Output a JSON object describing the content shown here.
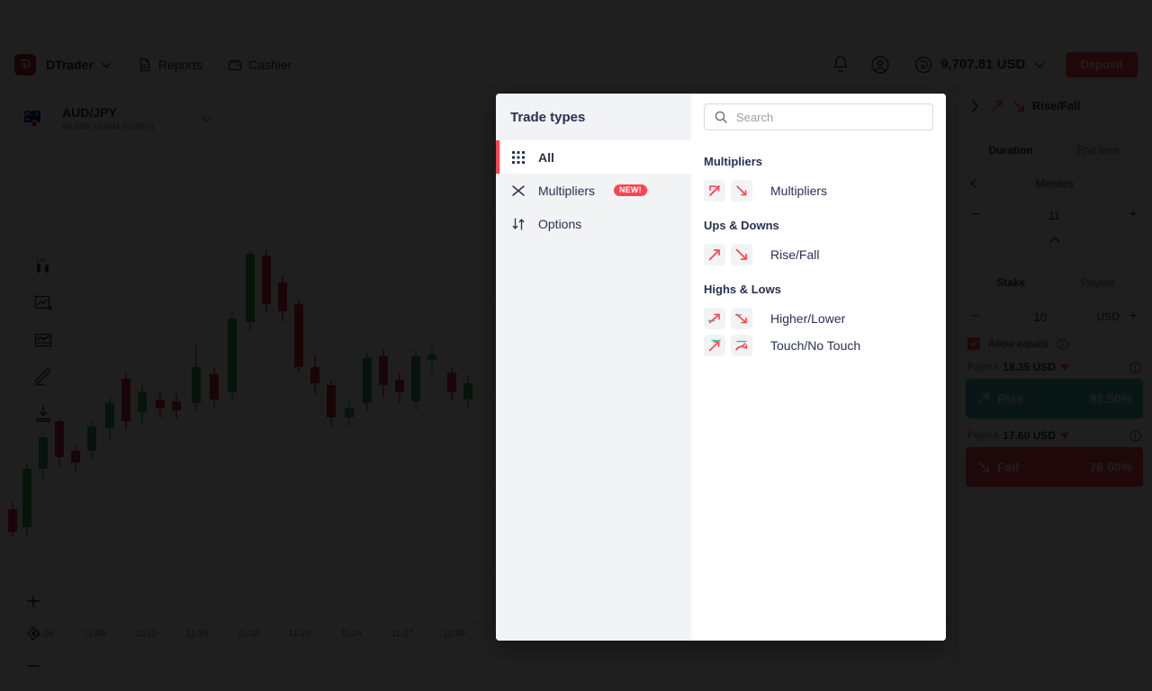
{
  "header": {
    "brand": "DTrader",
    "nav": [
      {
        "label": "Reports",
        "icon": "report-icon"
      },
      {
        "label": "Cashier",
        "icon": "cashier-icon"
      }
    ],
    "notification_icon": "bell-icon",
    "account_icon": "account-icon",
    "balance": "9,707.81 USD",
    "balance_icon": "currency-icon",
    "balance_chevron_icon": "chevron-down-icon",
    "deposit_label": "Deposit"
  },
  "chart": {
    "asset": {
      "name": "AUD/JPY",
      "sub": "89.686 +0.004 (0.00%)",
      "flag_icon": "aud-jpy-flag-icon",
      "chevron_icon": "chevron-down-icon"
    },
    "tools": [
      {
        "icon": "interval-1m-icon",
        "label": "1M"
      },
      {
        "icon": "chart-type-icon",
        "label": "Chart type"
      },
      {
        "icon": "indicators-icon",
        "label": "Indicators"
      },
      {
        "icon": "draw-icon",
        "label": "Drawing tools"
      },
      {
        "icon": "download-icon",
        "label": "Download"
      }
    ],
    "zoom_controls": [
      {
        "icon": "zoom-in-icon",
        "label": "+"
      },
      {
        "icon": "crosshair-icon",
        "label": ""
      },
      {
        "icon": "zoom-out-icon",
        "label": "−"
      }
    ],
    "x_ticks": [
      "11:06",
      "11:09",
      "11:12",
      "11:15",
      "11:18",
      "11:21",
      "11:24",
      "11:27",
      "11:30"
    ],
    "up_color": "#35a15b",
    "down_color": "#cc2e3d"
  },
  "chart_data": {
    "type": "candlestick",
    "title": "AUD/JPY",
    "xlabel": "",
    "ylabel": "",
    "x_ticks": [
      "11:06",
      "11:09",
      "11:12",
      "11:15",
      "11:18",
      "11:21",
      "11:24",
      "11:27",
      "11:30"
    ],
    "candles": [
      {
        "x": 14,
        "open": 470,
        "close": 495,
        "high": 462,
        "low": 500,
        "dir": "down"
      },
      {
        "x": 30,
        "open": 425,
        "close": 490,
        "high": 418,
        "low": 500,
        "dir": "up"
      },
      {
        "x": 48,
        "open": 390,
        "close": 425,
        "high": 385,
        "low": 437,
        "dir": "up"
      },
      {
        "x": 66,
        "open": 372,
        "close": 412,
        "high": 368,
        "low": 422,
        "dir": "down"
      },
      {
        "x": 84,
        "open": 405,
        "close": 418,
        "high": 398,
        "low": 428,
        "dir": "down"
      },
      {
        "x": 102,
        "open": 378,
        "close": 405,
        "high": 372,
        "low": 415,
        "dir": "up"
      },
      {
        "x": 122,
        "open": 352,
        "close": 380,
        "high": 345,
        "low": 392,
        "dir": "up"
      },
      {
        "x": 140,
        "open": 325,
        "close": 372,
        "high": 318,
        "low": 382,
        "dir": "down"
      },
      {
        "x": 158,
        "open": 340,
        "close": 362,
        "high": 332,
        "low": 375,
        "dir": "up"
      },
      {
        "x": 178,
        "open": 348,
        "close": 358,
        "high": 340,
        "low": 368,
        "dir": "down"
      },
      {
        "x": 196,
        "open": 350,
        "close": 360,
        "high": 342,
        "low": 370,
        "dir": "down"
      },
      {
        "x": 218,
        "open": 312,
        "close": 352,
        "high": 288,
        "low": 362,
        "dir": "up"
      },
      {
        "x": 238,
        "open": 320,
        "close": 348,
        "high": 312,
        "low": 358,
        "dir": "down"
      },
      {
        "x": 258,
        "open": 258,
        "close": 340,
        "high": 248,
        "low": 348,
        "dir": "up"
      },
      {
        "x": 278,
        "open": 186,
        "close": 262,
        "high": 182,
        "low": 272,
        "dir": "up"
      },
      {
        "x": 296,
        "open": 188,
        "close": 242,
        "high": 182,
        "low": 252,
        "dir": "down"
      },
      {
        "x": 314,
        "open": 218,
        "close": 250,
        "high": 210,
        "low": 262,
        "dir": "down"
      },
      {
        "x": 332,
        "open": 242,
        "close": 312,
        "high": 236,
        "low": 318,
        "dir": "down"
      },
      {
        "x": 350,
        "open": 312,
        "close": 330,
        "high": 298,
        "low": 342,
        "dir": "down"
      },
      {
        "x": 368,
        "open": 332,
        "close": 368,
        "high": 326,
        "low": 378,
        "dir": "down"
      },
      {
        "x": 388,
        "open": 358,
        "close": 368,
        "high": 350,
        "low": 378,
        "dir": "up"
      },
      {
        "x": 408,
        "open": 302,
        "close": 352,
        "high": 296,
        "low": 362,
        "dir": "up"
      },
      {
        "x": 426,
        "open": 300,
        "close": 332,
        "high": 292,
        "low": 345,
        "dir": "down"
      },
      {
        "x": 444,
        "open": 326,
        "close": 340,
        "high": 318,
        "low": 352,
        "dir": "down"
      },
      {
        "x": 462,
        "open": 300,
        "close": 350,
        "high": 292,
        "low": 360,
        "dir": "up"
      },
      {
        "x": 480,
        "open": 298,
        "close": 304,
        "high": 290,
        "low": 318,
        "dir": "up"
      },
      {
        "x": 502,
        "open": 318,
        "close": 340,
        "high": 312,
        "low": 350,
        "dir": "down"
      },
      {
        "x": 520,
        "open": 330,
        "close": 348,
        "high": 322,
        "low": 358,
        "dir": "up"
      }
    ]
  },
  "trade_panel": {
    "title": "Rise/Fall",
    "back_icon": "chevron-right-icon",
    "rise_icon": "arrow-up-right-icon",
    "fall_icon": "arrow-down-right-icon",
    "duration_tabs": [
      {
        "label": "Duration",
        "active": true
      },
      {
        "label": "End time",
        "active": false
      }
    ],
    "duration_unit": "Minutes",
    "duration_value": "11",
    "minus": "−",
    "plus": "+",
    "stake_tabs": [
      {
        "label": "Stake",
        "active": true
      },
      {
        "label": "Payout",
        "active": false
      }
    ],
    "stake_value": "10",
    "currency": "USD",
    "allow_equals_label": "Allow equals",
    "rise": {
      "payout_label": "Payout",
      "payout_value": "18.35 USD",
      "button_label": "Rise",
      "percent": "83.50%"
    },
    "fall": {
      "payout_label": "Payout",
      "payout_value": "17.60 USD",
      "button_label": "Fall",
      "percent": "76.00%"
    }
  },
  "modal": {
    "title": "Trade types",
    "search": {
      "placeholder": "Search",
      "value": "",
      "icon": "search-icon"
    },
    "sidebar": [
      {
        "label": "All",
        "icon": "grid-icon",
        "active": true,
        "badge": ""
      },
      {
        "label": "Multipliers",
        "icon": "multipliers-icon",
        "active": false,
        "badge": "NEW!"
      },
      {
        "label": "Options",
        "icon": "options-icon",
        "active": false,
        "badge": ""
      }
    ],
    "categories": [
      {
        "title": "Multipliers",
        "items": [
          {
            "label": "Multipliers",
            "icon_up": "multiplier-up-icon",
            "icon_down": "multiplier-down-icon"
          }
        ]
      },
      {
        "title": "Ups & Downs",
        "items": [
          {
            "label": "Rise/Fall",
            "icon_up": "rise-icon",
            "icon_down": "fall-icon"
          }
        ]
      },
      {
        "title": "Highs & Lows",
        "items": [
          {
            "label": "Higher/Lower",
            "icon_up": "higher-icon",
            "icon_down": "lower-icon"
          },
          {
            "label": "Touch/No Touch",
            "icon_up": "touch-icon",
            "icon_down": "no-touch-icon"
          }
        ]
      }
    ]
  },
  "colors": {
    "accent_red": "#ff444f",
    "brand_dark_red": "#b32a2a",
    "text": "#2a3052",
    "muted": "#6e6e6e",
    "sidebar_bg": "#f2f3f4",
    "teal": "#4bb4b3"
  }
}
